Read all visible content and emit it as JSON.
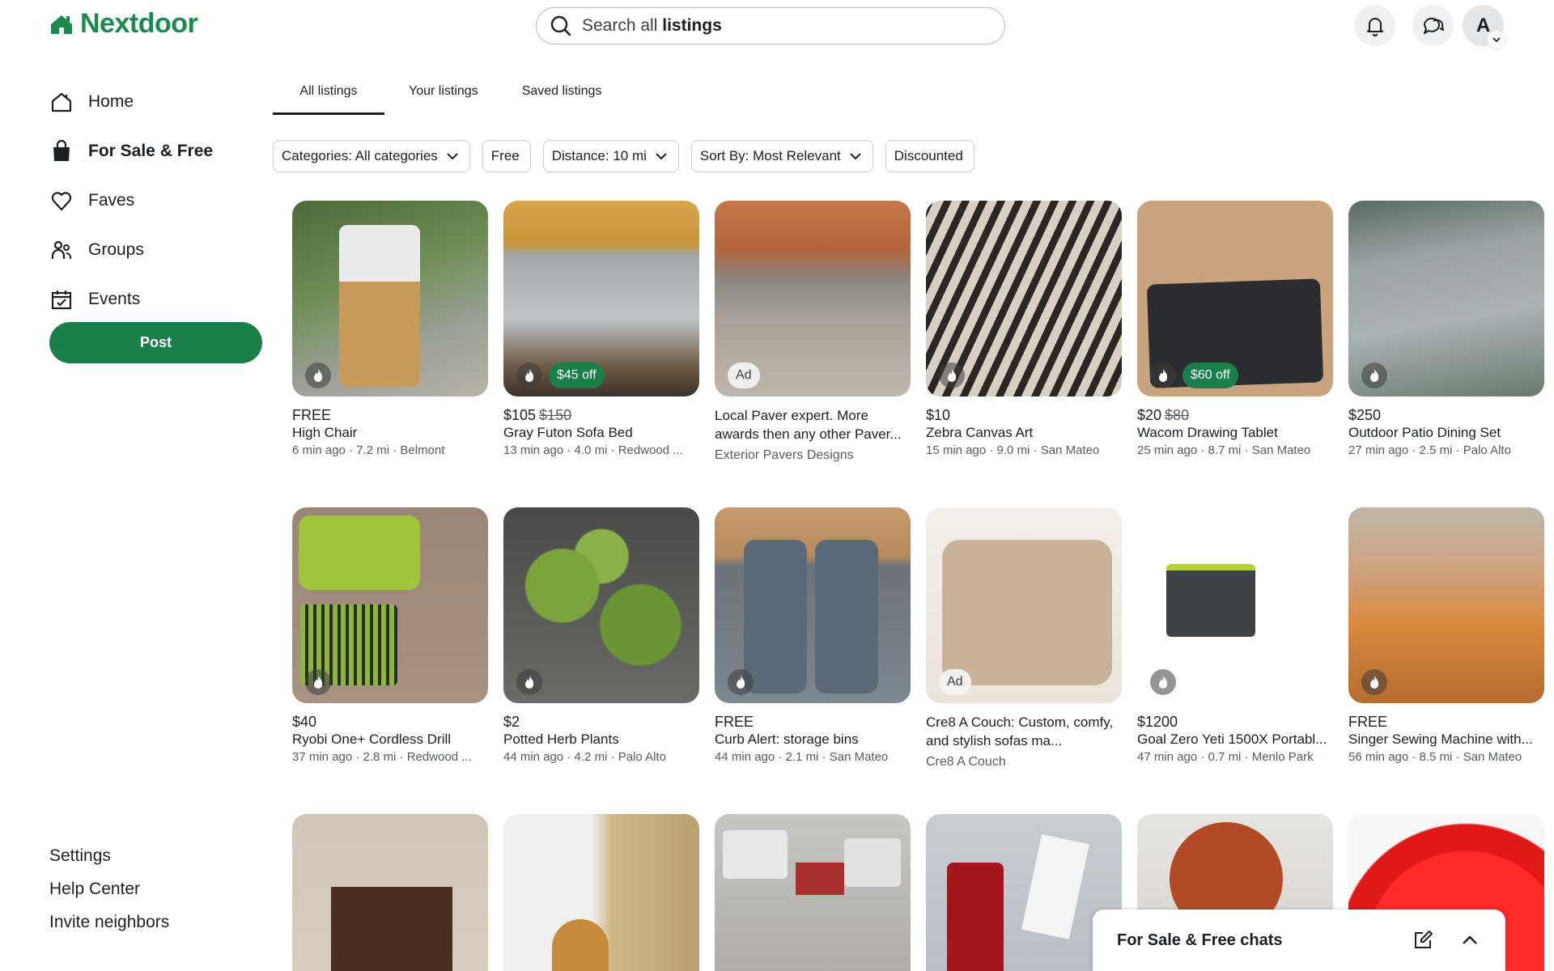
{
  "app": {
    "name": "Nextdoor",
    "brand_color": "#1b8a4c",
    "accent_color": "#1b7f49"
  },
  "search": {
    "prefix": "Search all",
    "bold": "listings"
  },
  "header": {
    "notifications_icon": "bell-icon",
    "messages_icon": "chat-bubbles-icon",
    "avatar_initial": "A"
  },
  "sidebar": {
    "items": [
      {
        "label": "Home",
        "icon": "house-icon"
      },
      {
        "label": "For Sale & Free",
        "icon": "shopping-bag-icon",
        "active": true
      },
      {
        "label": "Faves",
        "icon": "heart-icon"
      },
      {
        "label": "Groups",
        "icon": "people-icon"
      },
      {
        "label": "Events",
        "icon": "calendar-check-icon"
      }
    ],
    "post_label": "Post",
    "footer": [
      "Settings",
      "Help Center",
      "Invite neighbors"
    ]
  },
  "tabs": [
    "All listings",
    "Your listings",
    "Saved listings"
  ],
  "filters": [
    "Categories: All categories",
    "Free",
    "Distance: 10 mi",
    "Sort By: Most Relevant",
    "Discounted"
  ],
  "listings": [
    {
      "price": "FREE",
      "old_price": "",
      "title": "High Chair",
      "meta": "6 min ago · 7.2 mi · Belmont",
      "badge": ""
    },
    {
      "price": "$105",
      "old_price": "$150",
      "title": "Gray Futon Sofa Bed",
      "meta": "13 min ago · 4.0 mi · Redwood ...",
      "badge": "$45 off"
    },
    {
      "ad": true,
      "ad_title": "Local Paver expert. More awards then any other Paver...",
      "sponsor": "Exterior Pavers Designs",
      "ad_label": "Ad"
    },
    {
      "price": "$10",
      "old_price": "",
      "title": "Zebra Canvas Art",
      "meta": "15 min ago · 9.0 mi · San Mateo",
      "badge": ""
    },
    {
      "price": "$20",
      "old_price": "$80",
      "title": "Wacom Drawing Tablet",
      "meta": "25 min ago · 8.7 mi · San Mateo",
      "badge": "$60 off"
    },
    {
      "price": "$250",
      "old_price": "",
      "title": "Outdoor Patio Dining Set",
      "meta": "27 min ago · 2.5 mi · Palo Alto",
      "badge": ""
    },
    {
      "price": "$40",
      "old_price": "",
      "title": "Ryobi One+ Cordless Drill",
      "meta": "37 min ago · 2.8 mi · Redwood ...",
      "badge": ""
    },
    {
      "price": "$2",
      "old_price": "",
      "title": "Potted Herb Plants",
      "meta": "44 min ago · 4.2 mi · Palo Alto",
      "badge": ""
    },
    {
      "price": "FREE",
      "old_price": "",
      "title": "Curb Alert: storage bins",
      "meta": "44 min ago · 2.1 mi · San Mateo",
      "badge": ""
    },
    {
      "ad": true,
      "ad_title": "Cre8 A Couch: Custom, comfy, and stylish sofas ma...",
      "sponsor": "Cre8 A Couch",
      "ad_label": "Ad"
    },
    {
      "price": "$1200",
      "old_price": "",
      "title": "Goal Zero Yeti 1500X Portabl...",
      "meta": "47 min ago · 0.7 mi · Menlo Park",
      "badge": ""
    },
    {
      "price": "FREE",
      "old_price": "",
      "title": "Singer Sewing Machine with...",
      "meta": "56 min ago · 8.5 mi · San Mateo",
      "badge": ""
    }
  ],
  "chats": {
    "label": "For Sale & Free chats"
  }
}
